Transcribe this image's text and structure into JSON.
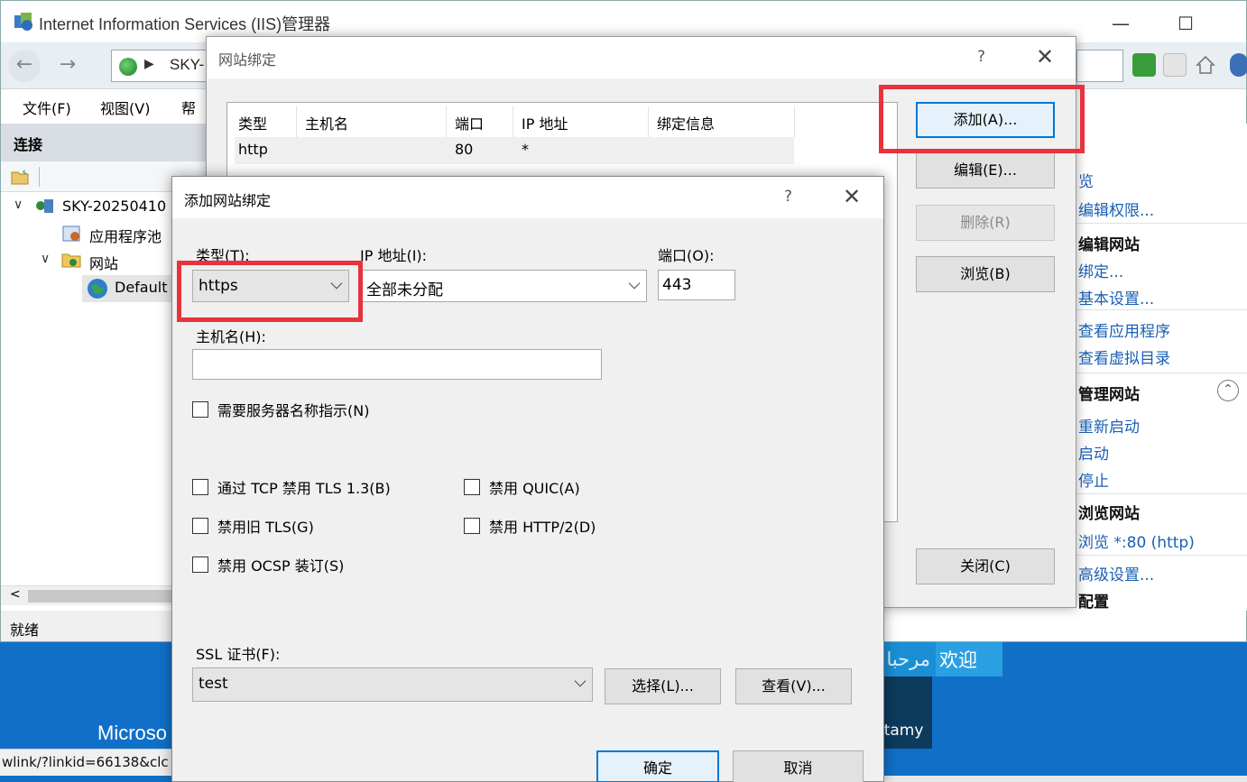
{
  "window": {
    "title": "Internet Information Services (IIS)管理器",
    "address_text": "SKY-",
    "menu": [
      "文件(F)",
      "视图(V)",
      "帮"
    ],
    "connections_header": "连接",
    "tree": {
      "server": "SKY-20250410",
      "app_pools": "应用程序池",
      "sites": "网站",
      "default_site": "Default"
    },
    "status": "就绪",
    "actions": {
      "a1": "览",
      "a2": "编辑权限...",
      "h1": "编辑网站",
      "a3": "绑定...",
      "a4": "基本设置...",
      "a5": "查看应用程序",
      "a6": "查看虚拟目录",
      "h2": "管理网站",
      "a7": "重新启动",
      "a8": "启动",
      "a9": "停止",
      "h3": "浏览网站",
      "a10": "浏览 *:80 (http)",
      "a11": "高级设置...",
      "a12": "配置"
    }
  },
  "background": {
    "microsoft_text": "Microso",
    "welcome_ar": "مرحبا",
    "welcome_zh": "欢迎",
    "tile_text": "itamy",
    "url_text": "wlink/?linkid=66138&clc"
  },
  "bindings_dialog": {
    "title": "网站绑定",
    "help": "?",
    "close": "✕",
    "columns": [
      "类型",
      "主机名",
      "端口",
      "IP 地址",
      "绑定信息"
    ],
    "rows": [
      {
        "type": "http",
        "host": "",
        "port": "80",
        "ip": "*",
        "info": ""
      }
    ],
    "buttons": {
      "add": "添加(A)...",
      "edit": "编辑(E)...",
      "remove": "删除(R)",
      "browse": "浏览(B)",
      "close": "关闭(C)"
    }
  },
  "add_dialog": {
    "title": "添加网站绑定",
    "help": "?",
    "close": "✕",
    "type_label": "类型(T):",
    "type_value": "https",
    "ip_label": "IP 地址(I):",
    "ip_value": "全部未分配",
    "port_label": "端口(O):",
    "port_value": "443",
    "host_label": "主机名(H):",
    "host_value": "",
    "sni": "需要服务器名称指示(N)",
    "tls13": "通过 TCP 禁用 TLS 1.3(B)",
    "quic": "禁用 QUIC(A)",
    "legacy_tls": "禁用旧 TLS(G)",
    "http2": "禁用 HTTP/2(D)",
    "ocsp": "禁用 OCSP 装订(S)",
    "ssl_label": "SSL 证书(F):",
    "ssl_value": "test",
    "select": "选择(L)...",
    "view": "查看(V)...",
    "ok": "确定",
    "cancel": "取消"
  },
  "colors": {
    "highlight_red": "#e8323c",
    "primary_blue": "#0078d7",
    "link_blue": "#1a5fb4"
  }
}
